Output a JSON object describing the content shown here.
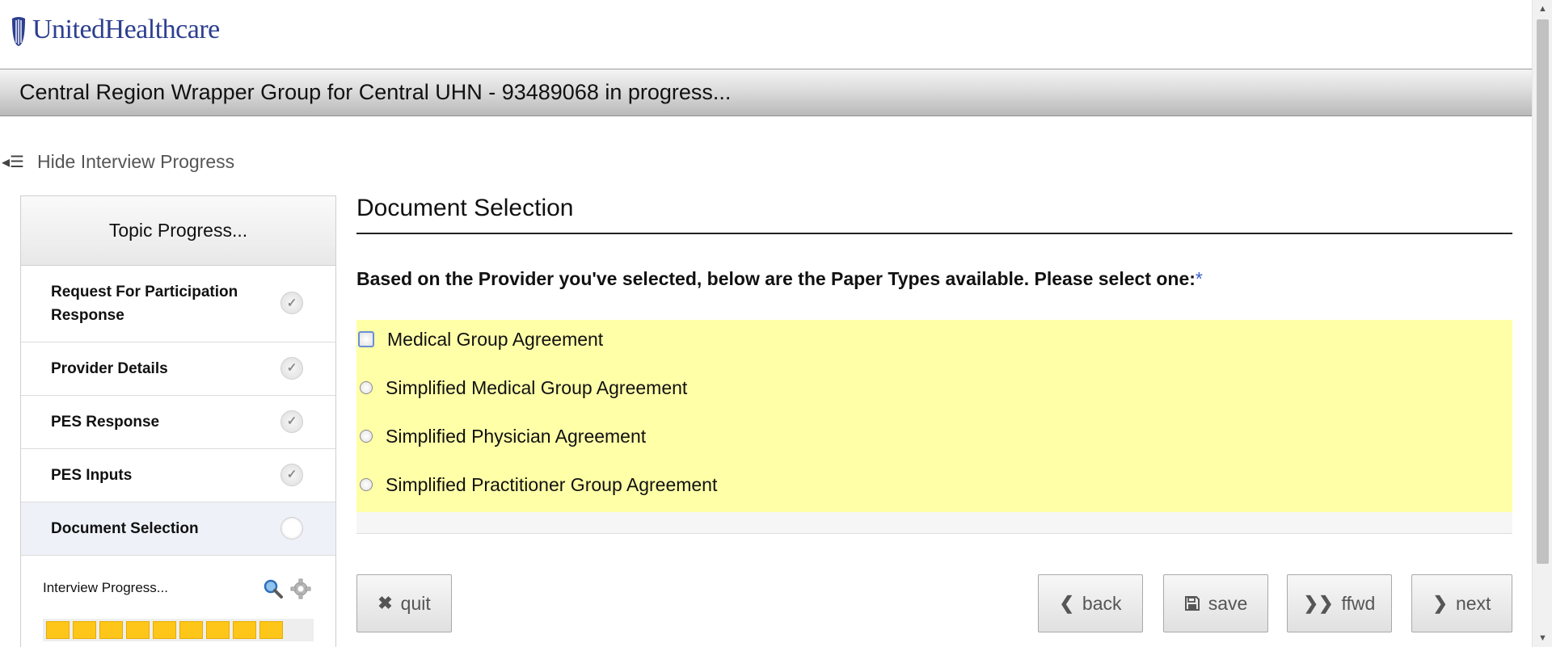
{
  "brand": {
    "name": "UnitedHealthcare",
    "color": "#2d3f8f"
  },
  "header": {
    "title": "Central Region Wrapper Group for Central UHN - 93489068 in progress..."
  },
  "toggle": {
    "label": "Hide Interview Progress",
    "icon": "collapse-menu-icon"
  },
  "sidebar": {
    "heading": "Topic Progress...",
    "topics": [
      {
        "label": "Request For Participation Response",
        "status": "complete"
      },
      {
        "label": "Provider Details",
        "status": "complete"
      },
      {
        "label": "PES Response",
        "status": "complete"
      },
      {
        "label": "PES Inputs",
        "status": "complete"
      },
      {
        "label": "Document Selection",
        "status": "current"
      }
    ],
    "interview_progress": {
      "label": "Interview Progress...",
      "filled_segments": 9,
      "bar_color": "#ffc61a",
      "icons": [
        "zoom-icon",
        "gear-icon"
      ]
    }
  },
  "main": {
    "title": "Document Selection",
    "question": "Based on the Provider you've selected, below are the Paper Types available. Please select one:",
    "required_marker": "*",
    "highlight_color": "#ffffa8",
    "options": [
      {
        "label": "Medical Group Agreement",
        "selected": false
      },
      {
        "label": "Simplified Medical Group Agreement",
        "selected": false
      },
      {
        "label": "Simplified Physician Agreement",
        "selected": false
      },
      {
        "label": "Simplified Practitioner Group Agreement",
        "selected": false
      }
    ]
  },
  "buttons": {
    "quit": "quit",
    "back": "back",
    "save": "save",
    "ffwd": "ffwd",
    "next": "next"
  },
  "icons": {
    "quit": "close-icon",
    "back": "chevron-left-icon",
    "save": "floppy-disk-icon",
    "ffwd": "double-chevron-right-icon",
    "next": "chevron-right-icon"
  }
}
